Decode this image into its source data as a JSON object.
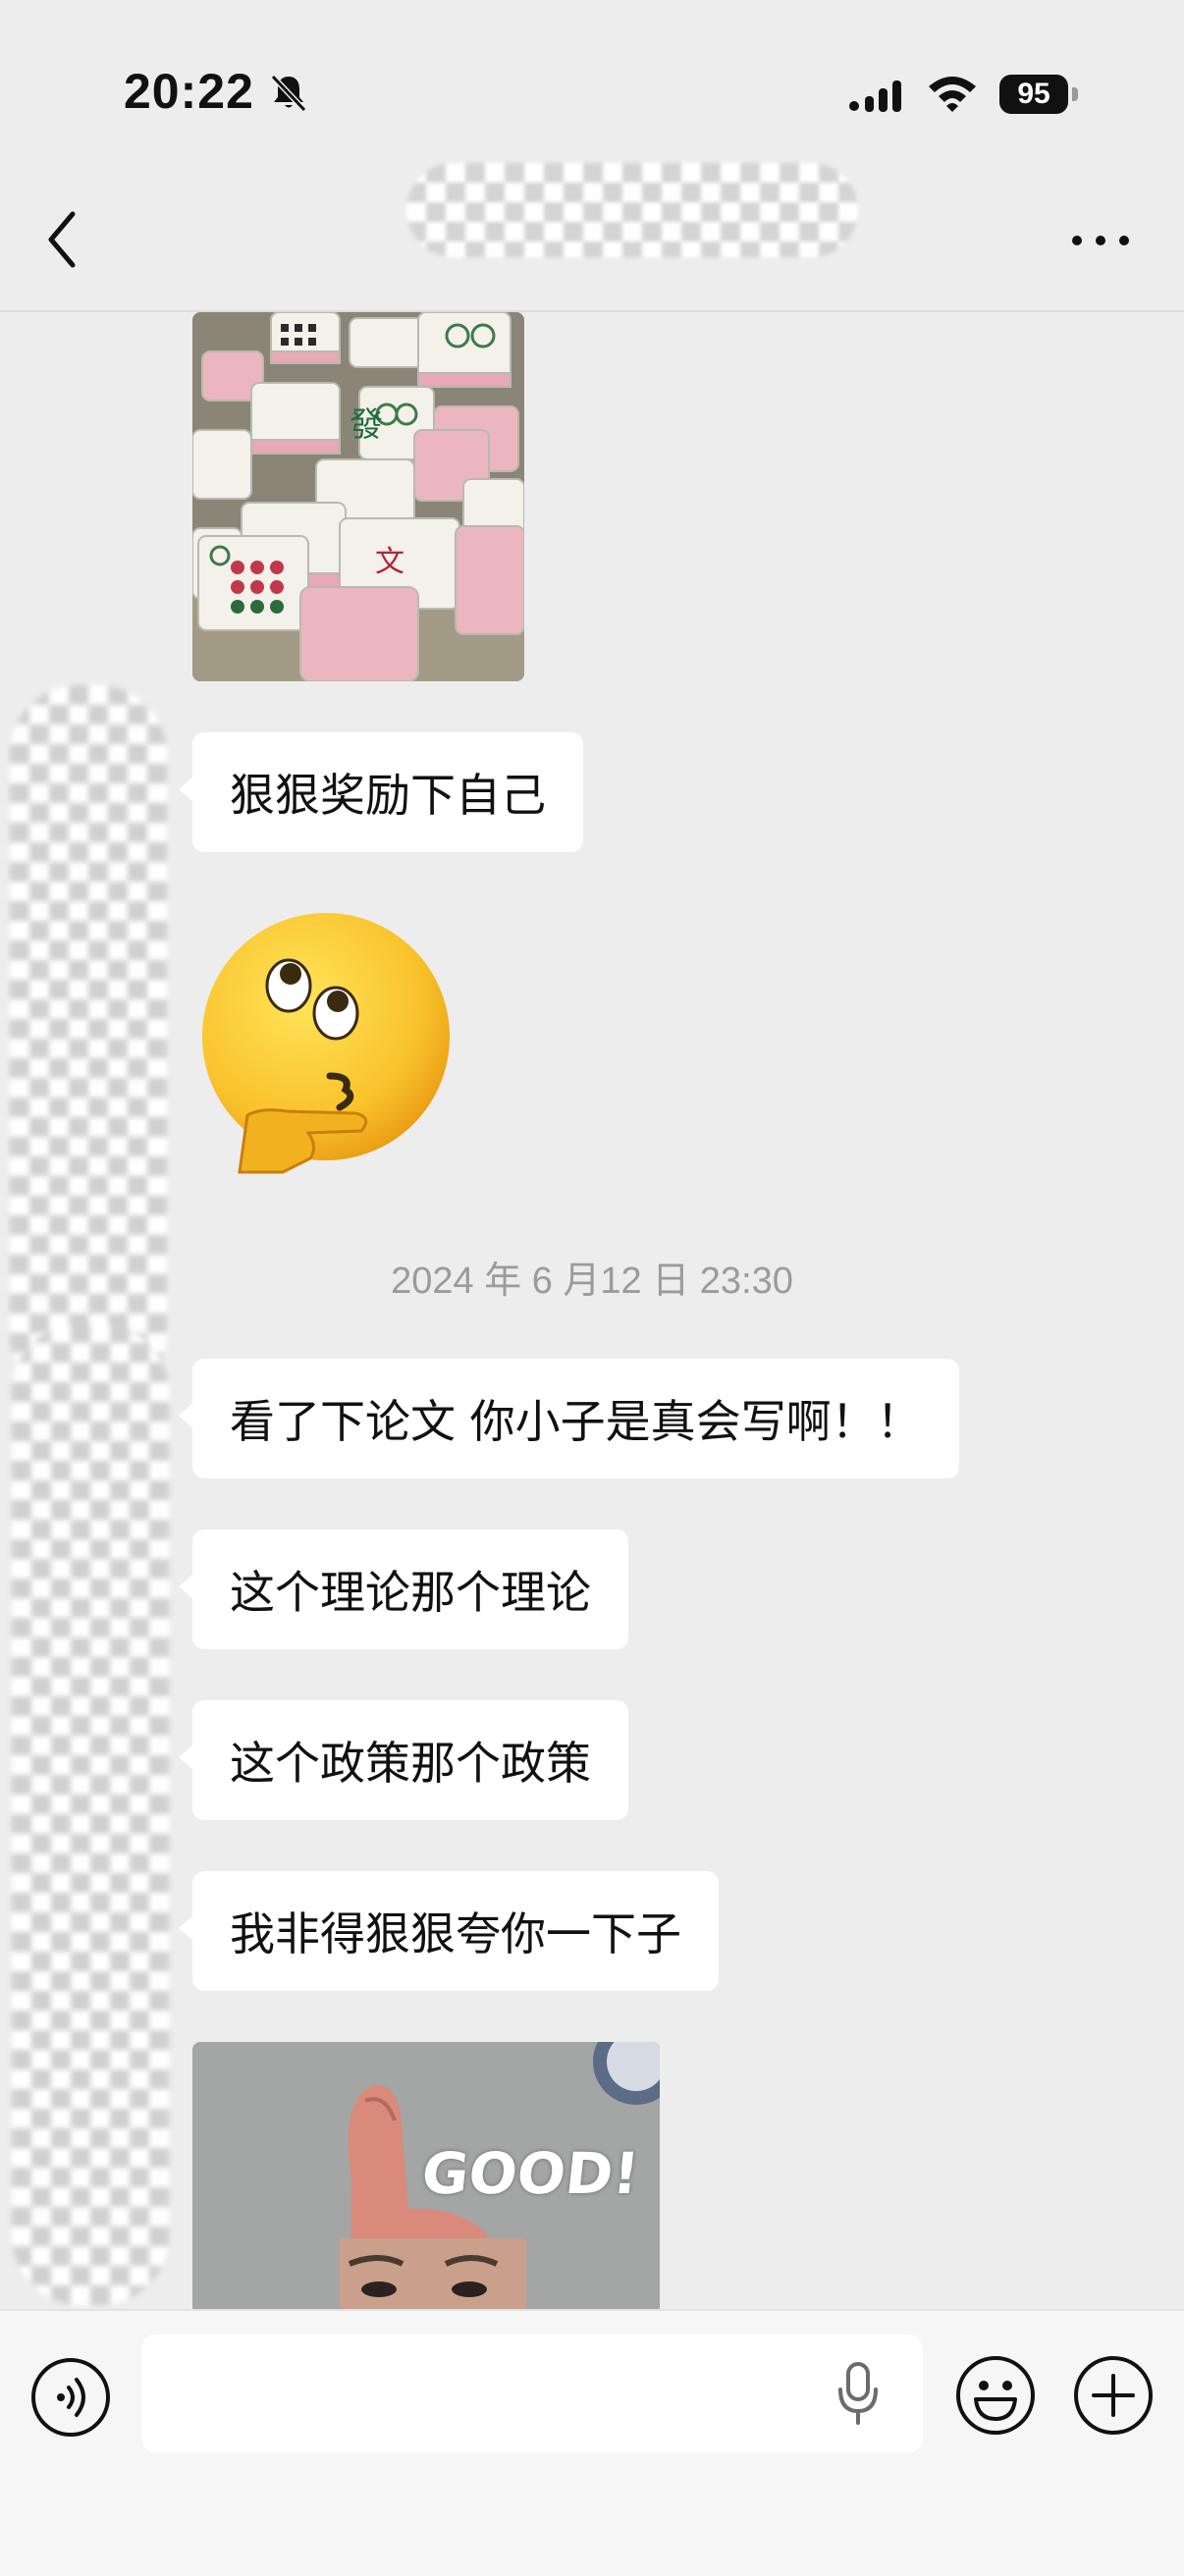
{
  "status_bar": {
    "time": "20:22",
    "battery": "95"
  },
  "nav": {
    "back_icon": "chevron-left-icon",
    "more_icon": "ellipsis-icon"
  },
  "messages": {
    "reward_text": "狠狠奖励下自己",
    "timestamp": "2024 年 6 月12 日 23:30",
    "paper_text": "看了下论文 你小子是真会写啊！！",
    "theory_text": "这个理论那个理论",
    "policy_text": "这个政策那个政策",
    "praise_text": "我非得狠狠夸你一下子",
    "good_sticker_caption": "GOOD!"
  },
  "input_bar": {
    "placeholder": "",
    "voice_icon": "voice-icon",
    "mic_icon": "mic-icon",
    "emoji_icon": "emoji-icon",
    "add_icon": "plus-icon"
  },
  "colors": {
    "background": "#ededed",
    "bubble": "#ffffff",
    "timestamp": "#9b9b9b"
  }
}
